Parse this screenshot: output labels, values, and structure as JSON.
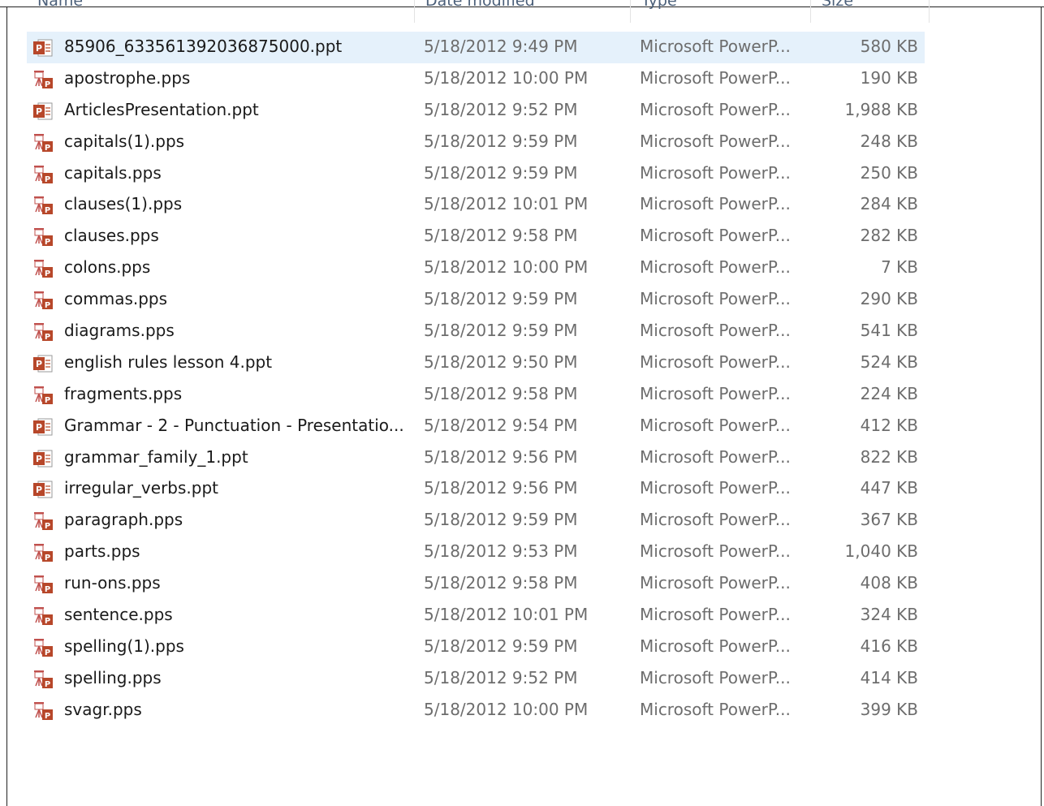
{
  "header": {
    "name_label": "Name",
    "date_label": "Date modified",
    "type_label": "Type",
    "size_label": "Size"
  },
  "colors": {
    "selected_row": "#e5f1fb",
    "ppt_icon": "#b7472a",
    "muted_text": "#6d6d6d"
  },
  "files": [
    {
      "name": "85906_633561392036875000.ppt",
      "date": "5/18/2012 9:49 PM",
      "type": "Microsoft PowerP...",
      "size": "580 KB",
      "icon": "ppt-file-icon",
      "selected": true
    },
    {
      "name": "apostrophe.pps",
      "date": "5/18/2012 10:00 PM",
      "type": "Microsoft PowerP...",
      "size": "190 KB",
      "icon": "pps-file-icon",
      "selected": false
    },
    {
      "name": "ArticlesPresentation.ppt",
      "date": "5/18/2012 9:52 PM",
      "type": "Microsoft PowerP...",
      "size": "1,988 KB",
      "icon": "ppt-file-icon",
      "selected": false
    },
    {
      "name": "capitals(1).pps",
      "date": "5/18/2012 9:59 PM",
      "type": "Microsoft PowerP...",
      "size": "248 KB",
      "icon": "pps-file-icon",
      "selected": false
    },
    {
      "name": "capitals.pps",
      "date": "5/18/2012 9:59 PM",
      "type": "Microsoft PowerP...",
      "size": "250 KB",
      "icon": "pps-file-icon",
      "selected": false
    },
    {
      "name": "clauses(1).pps",
      "date": "5/18/2012 10:01 PM",
      "type": "Microsoft PowerP...",
      "size": "284 KB",
      "icon": "pps-file-icon",
      "selected": false
    },
    {
      "name": "clauses.pps",
      "date": "5/18/2012 9:58 PM",
      "type": "Microsoft PowerP...",
      "size": "282 KB",
      "icon": "pps-file-icon",
      "selected": false
    },
    {
      "name": "colons.pps",
      "date": "5/18/2012 10:00 PM",
      "type": "Microsoft PowerP...",
      "size": "7 KB",
      "icon": "pps-file-icon",
      "selected": false
    },
    {
      "name": "commas.pps",
      "date": "5/18/2012 9:59 PM",
      "type": "Microsoft PowerP...",
      "size": "290 KB",
      "icon": "pps-file-icon",
      "selected": false
    },
    {
      "name": "diagrams.pps",
      "date": "5/18/2012 9:59 PM",
      "type": "Microsoft PowerP...",
      "size": "541 KB",
      "icon": "pps-file-icon",
      "selected": false
    },
    {
      "name": "english rules lesson 4.ppt",
      "date": "5/18/2012 9:50 PM",
      "type": "Microsoft PowerP...",
      "size": "524 KB",
      "icon": "ppt-file-icon",
      "selected": false
    },
    {
      "name": "fragments.pps",
      "date": "5/18/2012 9:58 PM",
      "type": "Microsoft PowerP...",
      "size": "224 KB",
      "icon": "pps-file-icon",
      "selected": false
    },
    {
      "name": "Grammar - 2 - Punctuation - Presentatio...",
      "date": "5/18/2012 9:54 PM",
      "type": "Microsoft PowerP...",
      "size": "412 KB",
      "icon": "ppt-file-icon",
      "selected": false
    },
    {
      "name": "grammar_family_1.ppt",
      "date": "5/18/2012 9:56 PM",
      "type": "Microsoft PowerP...",
      "size": "822 KB",
      "icon": "ppt-file-icon",
      "selected": false
    },
    {
      "name": "irregular_verbs.ppt",
      "date": "5/18/2012 9:56 PM",
      "type": "Microsoft PowerP...",
      "size": "447 KB",
      "icon": "ppt-file-icon",
      "selected": false
    },
    {
      "name": "paragraph.pps",
      "date": "5/18/2012 9:59 PM",
      "type": "Microsoft PowerP...",
      "size": "367 KB",
      "icon": "pps-file-icon",
      "selected": false
    },
    {
      "name": "parts.pps",
      "date": "5/18/2012 9:53 PM",
      "type": "Microsoft PowerP...",
      "size": "1,040 KB",
      "icon": "pps-file-icon",
      "selected": false
    },
    {
      "name": "run-ons.pps",
      "date": "5/18/2012 9:58 PM",
      "type": "Microsoft PowerP...",
      "size": "408 KB",
      "icon": "pps-file-icon",
      "selected": false
    },
    {
      "name": "sentence.pps",
      "date": "5/18/2012 10:01 PM",
      "type": "Microsoft PowerP...",
      "size": "324 KB",
      "icon": "pps-file-icon",
      "selected": false
    },
    {
      "name": "spelling(1).pps",
      "date": "5/18/2012 9:59 PM",
      "type": "Microsoft PowerP...",
      "size": "416 KB",
      "icon": "pps-file-icon",
      "selected": false
    },
    {
      "name": "spelling.pps",
      "date": "5/18/2012 9:52 PM",
      "type": "Microsoft PowerP...",
      "size": "414 KB",
      "icon": "pps-file-icon",
      "selected": false
    },
    {
      "name": "svagr.pps",
      "date": "5/18/2012 10:00 PM",
      "type": "Microsoft PowerP...",
      "size": "399 KB",
      "icon": "pps-file-icon",
      "selected": false
    }
  ]
}
